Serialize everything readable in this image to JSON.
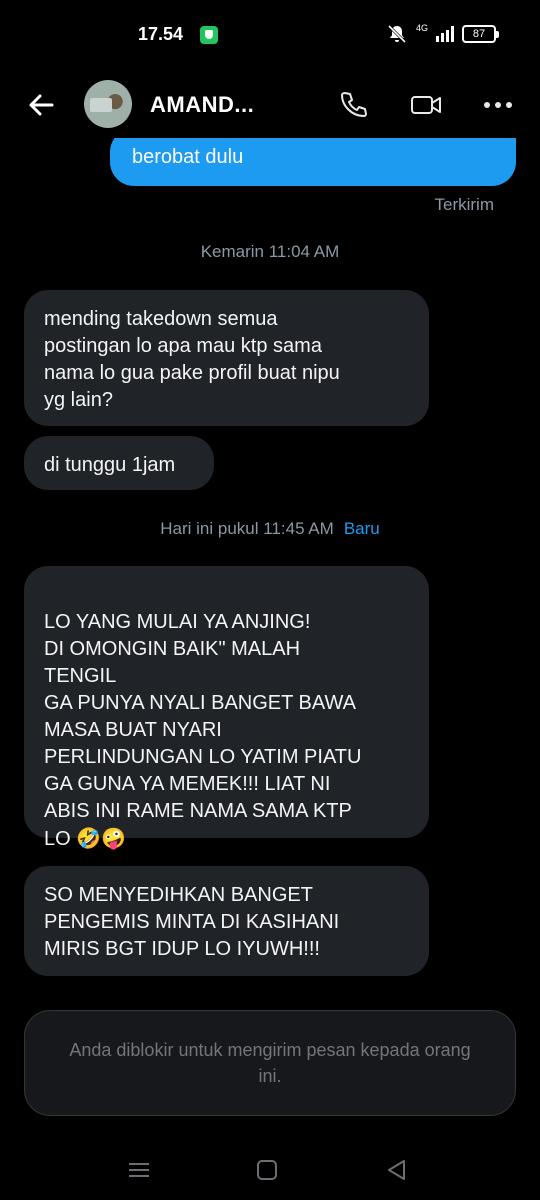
{
  "status_bar": {
    "time": "17.54",
    "network": "4G",
    "battery": "87"
  },
  "header": {
    "contact_name": "AMAND...",
    "icons": [
      "back-arrow-icon",
      "phone-icon",
      "video-icon",
      "more-icon"
    ]
  },
  "messages": {
    "outgoing_last": "berobat dulu",
    "sent_status": "Terkirim",
    "separator_1": "Kemarin 11:04 AM",
    "incoming_1": "mending takedown semua\npostingan lo apa mau ktp sama\nnama lo gua pake profil buat nipu\nyg lain?",
    "incoming_2": "di tunggu 1jam",
    "separator_2": "Hari ini pukul 11:45 AM",
    "new_label": "Baru",
    "incoming_3": "LO YANG MULAI YA ANJING!\nDI OMONGIN BAIK\" MALAH\nTENGIL\nGA PUNYA NYALI BANGET BAWA\nMASA BUAT NYARI\nPERLINDUNGAN LO YATIM PIATU\nGA GUNA YA MEMEK!!! LIAT NI\nABIS INI RAME NAMA SAMA KTP\nLO",
    "incoming_3_emoji": "🤣🤪",
    "incoming_4": "SO MENYEDIHKAN BANGET\nPENGEMIS MINTA DI KASIHANI\nMIRIS BGT IDUP LO IYUWH!!!"
  },
  "composer": {
    "blocked_text": "Anda diblokir untuk mengirim pesan kepada orang ini."
  },
  "nav": {
    "icons": [
      "recent-apps-icon",
      "home-icon",
      "back-icon"
    ]
  },
  "colors": {
    "accent": "#1d9bf0",
    "bubble_in": "#202327",
    "background": "#000000",
    "muted_text": "#8b98a5"
  }
}
